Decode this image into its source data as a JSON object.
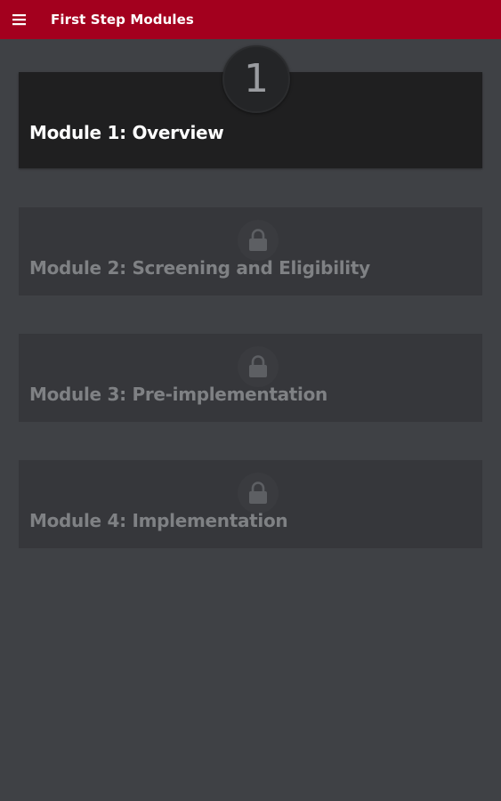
{
  "app_bar": {
    "title": "First Step Modules",
    "menu_icon": "hamburger-menu-icon",
    "color": "#a3001e"
  },
  "modules": [
    {
      "number": "1",
      "title": "Module 1: Overview",
      "state": "unlocked",
      "icon": "number-badge"
    },
    {
      "number": "2",
      "title": "Module 2: Screening and Eligibility",
      "state": "locked",
      "icon": "lock-icon"
    },
    {
      "number": "3",
      "title": "Module 3: Pre-implementation",
      "state": "locked",
      "icon": "lock-icon"
    },
    {
      "number": "4",
      "title": "Module 4: Implementation",
      "state": "locked",
      "icon": "lock-icon"
    }
  ],
  "colors": {
    "background": "#3f4145",
    "active_card": "#1f1f20",
    "locked_card": "#36373b",
    "locked_text": "#7f8184"
  }
}
